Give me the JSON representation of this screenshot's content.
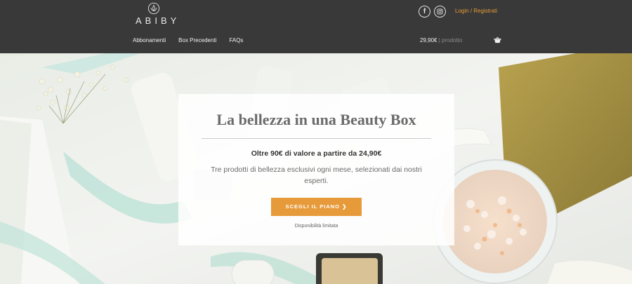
{
  "brand": {
    "name": "ABIBY",
    "logo_icon": "lotus-icon"
  },
  "nav": {
    "items": [
      {
        "label": "Abbonamenti"
      },
      {
        "label": "Box Precedenti"
      },
      {
        "label": "FAQs"
      }
    ]
  },
  "social": [
    {
      "name": "facebook-icon",
      "glyph": "f"
    },
    {
      "name": "instagram-icon"
    }
  ],
  "account": {
    "login_label": "Login / Registrati"
  },
  "cart": {
    "total": "29,90€",
    "separator": "|",
    "items_label": "prodotto",
    "icon": "basket-icon"
  },
  "hero": {
    "title": "La bellezza in una Beauty Box",
    "subtitle": "Oltre 90€ di valore a partire da 24,90€",
    "description": "Tre prodotti di bellezza esclusivi ogni mese, selezionati dai nostri esperti.",
    "cta_label": "SCEGLI IL PIANO ❯",
    "availability": "Disponibilità limitata"
  },
  "colors": {
    "header_bg": "#393939",
    "accent": "#e79a3a",
    "text_dark": "#333333",
    "text_muted": "#6a6a6a"
  }
}
